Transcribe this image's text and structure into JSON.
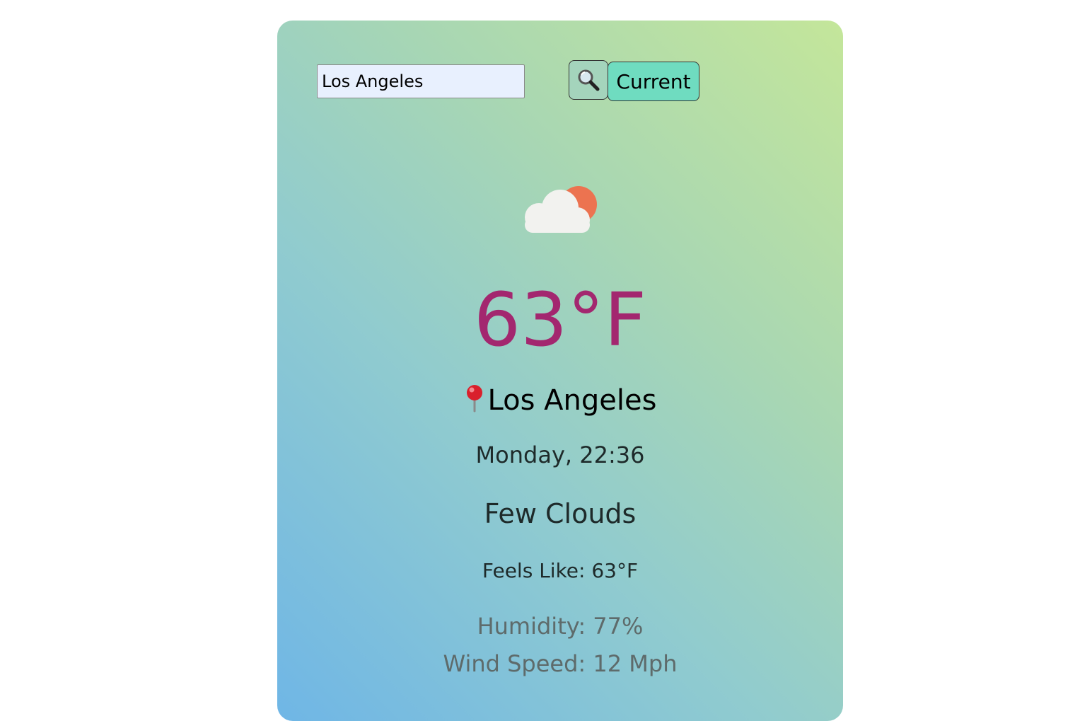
{
  "search": {
    "input_value": "Los Angeles",
    "search_button_icon": "magnifier-icon",
    "current_button_label": "Current"
  },
  "weather": {
    "icon": "few-clouds-icon",
    "temperature": "63°F",
    "location_icon": "pushpin-icon",
    "city": "Los Angeles",
    "datetime": "Monday, 22:36",
    "description": "Few Clouds",
    "feels_like": "Feels Like: 63°F",
    "humidity": "Humidity: 77%",
    "wind_speed": "Wind Speed: 12 Mph"
  },
  "colors": {
    "temperature": "#a3276f",
    "sun": "#ec7350",
    "cloud": "#f2f2ef",
    "current_button": "#6fdcc0",
    "input_background": "#e8f0fe"
  }
}
